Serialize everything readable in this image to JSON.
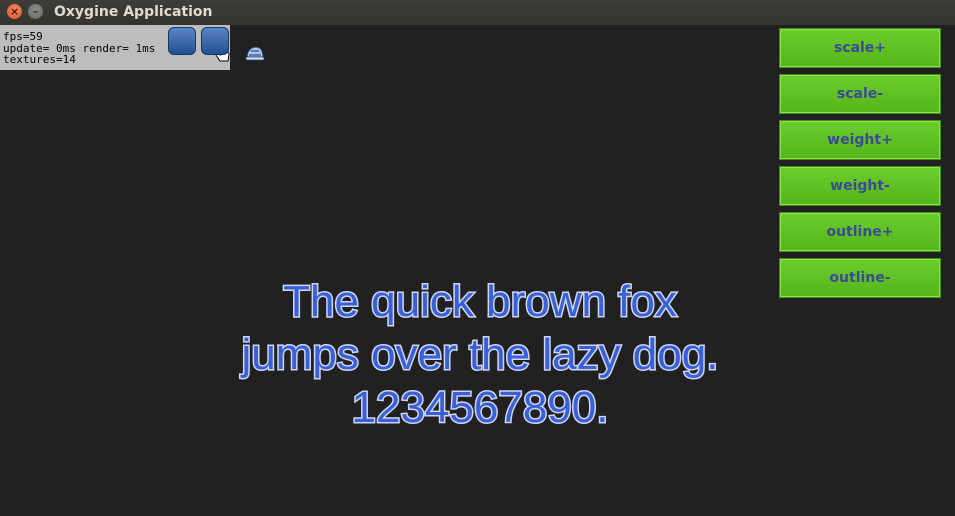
{
  "window": {
    "title": "Oxygine Application",
    "close_icon": "×",
    "minimize_icon": "–"
  },
  "debug": {
    "fps": "fps=59",
    "timing": "update= 0ms render= 1ms",
    "textures": "textures=14",
    "icons": [
      "touch-hand-icon",
      "helmet-icon"
    ]
  },
  "buttons": [
    {
      "label": "scale+"
    },
    {
      "label": "scale-"
    },
    {
      "label": "weight+"
    },
    {
      "label": "weight-"
    },
    {
      "label": "outline+"
    },
    {
      "label": "outline-"
    }
  ],
  "sample_text": {
    "line1": "The quick brown fox",
    "line2": "jumps over the lazy dog.",
    "line3": "1234567890."
  },
  "colors": {
    "button_green": "#5fbf22",
    "button_text": "#3a4a95",
    "text_fill": "#3a60d8",
    "text_outline": "#cfd6f2",
    "background": "#212121"
  }
}
